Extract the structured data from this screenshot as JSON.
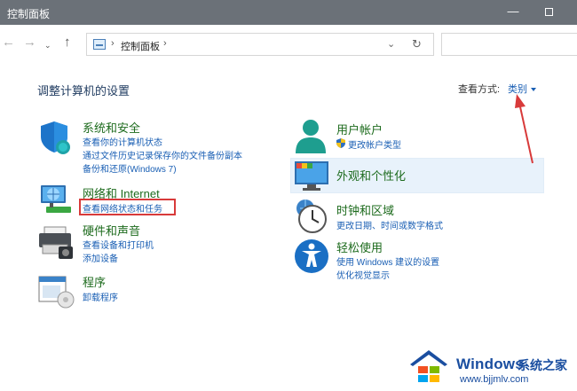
{
  "window": {
    "title": "控制面板",
    "minimize": "—"
  },
  "nav": {
    "back": "←",
    "forward": "→",
    "recent": "⌄",
    "up": "↑"
  },
  "address": {
    "separator": "›",
    "crumb": "控制面板",
    "dropdown": "⌄",
    "refresh": "↻"
  },
  "content": {
    "title": "调整计算机的设置",
    "view_by_label": "查看方式:",
    "view_mode": "类别"
  },
  "left_categories": [
    {
      "title": "系统和安全",
      "icon": "shield-icon",
      "links": [
        "查看你的计算机状态",
        "通过文件历史记录保存你的文件备份副本",
        "备份和还原(Windows 7)"
      ]
    },
    {
      "title": "网络和 Internet",
      "icon": "network-icon",
      "links": [
        "查看网络状态和任务"
      ]
    },
    {
      "title": "硬件和声音",
      "icon": "printer-icon",
      "links": [
        "查看设备和打印机",
        "添加设备"
      ]
    },
    {
      "title": "程序",
      "icon": "programs-icon",
      "links": [
        "卸载程序"
      ]
    }
  ],
  "right_categories": [
    {
      "title": "用户帐户",
      "icon": "user-icon",
      "links": [
        "更改帐户类型"
      ]
    },
    {
      "title": "外观和个性化",
      "icon": "monitor-icon",
      "links": []
    },
    {
      "title": "时钟和区域",
      "icon": "clock-icon",
      "links": [
        "更改日期、时间或数字格式"
      ]
    },
    {
      "title": "轻松使用",
      "icon": "accessibility-icon",
      "links": [
        "使用 Windows 建议的设置",
        "优化视觉显示"
      ]
    }
  ],
  "watermark": {
    "brand": "Windows",
    "brand_cn": "系统之家",
    "url": "www.bjjmlv.com"
  },
  "colors": {
    "titlebar": "#6b7178",
    "category_title": "#1d6b1d",
    "link": "#1a5fb4",
    "annotation": "#d83a3a"
  }
}
